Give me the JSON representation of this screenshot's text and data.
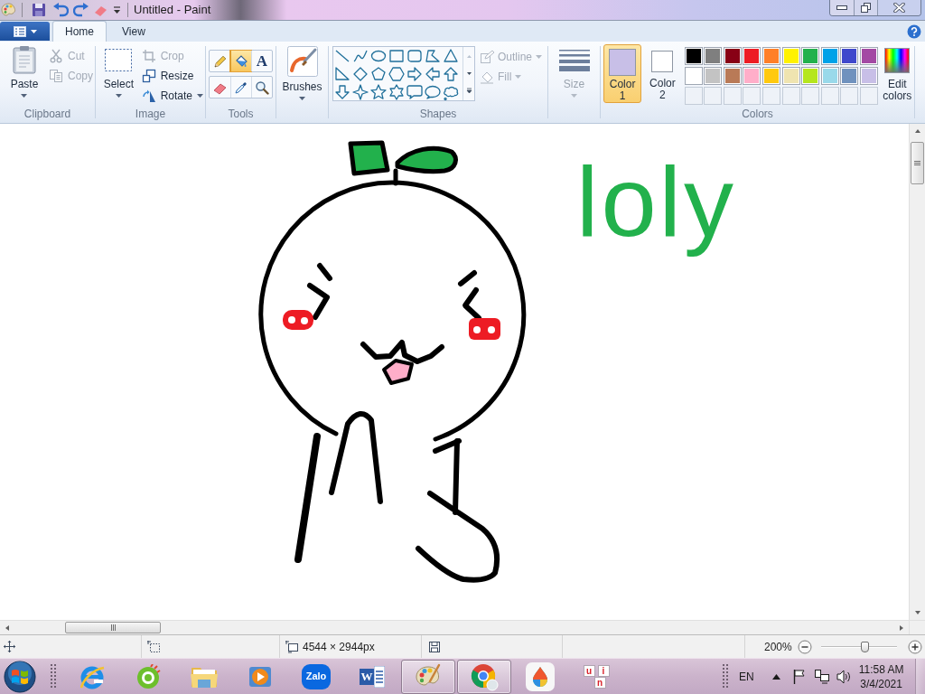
{
  "title_bar": {
    "title": "Untitled - Paint"
  },
  "ribbon_tabs": [
    {
      "label": "Home",
      "selected": true
    },
    {
      "label": "View",
      "selected": false
    }
  ],
  "clipboard": {
    "label": "Clipboard",
    "paste": {
      "label": "Paste"
    },
    "items": [
      {
        "kind": "cut",
        "label": "Cut",
        "disabled": true
      },
      {
        "kind": "copy",
        "label": "Copy",
        "disabled": true
      }
    ]
  },
  "image": {
    "label": "Image",
    "select": {
      "label": "Select"
    },
    "items": [
      {
        "kind": "crop",
        "label": "Crop",
        "disabled": true,
        "dropdown": false
      },
      {
        "kind": "resize",
        "label": "Resize",
        "disabled": false,
        "dropdown": false
      },
      {
        "kind": "rotate",
        "label": "Rotate",
        "disabled": false,
        "dropdown": true
      }
    ]
  },
  "tools": {
    "label": "Tools",
    "items": [
      {
        "kind": "pencil",
        "selected": false
      },
      {
        "kind": "fill",
        "selected": true
      },
      {
        "kind": "text",
        "label": "A",
        "selected": false
      },
      {
        "kind": "eraser",
        "selected": false
      },
      {
        "kind": "picker",
        "selected": false
      },
      {
        "kind": "magnifier",
        "selected": false
      }
    ]
  },
  "brushes": {
    "label": "Brushes"
  },
  "shapes": {
    "label": "Shapes",
    "outline": {
      "label": "Outline",
      "disabled": true
    },
    "fill": {
      "label": "Fill",
      "disabled": true
    }
  },
  "size": {
    "label": "Size",
    "disabled": true
  },
  "colors": {
    "label": "Colors",
    "slots": [
      {
        "label": "Color 1",
        "color": "#c8bfe7",
        "selected": true
      },
      {
        "label": "Color 2",
        "color": "#ffffff",
        "selected": false
      }
    ],
    "palette": [
      {
        "color": "#000000"
      },
      {
        "color": "#7f7f7f"
      },
      {
        "color": "#880015"
      },
      {
        "color": "#ed1c24"
      },
      {
        "color": "#ff7f27"
      },
      {
        "color": "#fff200"
      },
      {
        "color": "#22b14c"
      },
      {
        "color": "#00a2e8"
      },
      {
        "color": "#3f48cc"
      },
      {
        "color": "#a349a4"
      },
      {
        "color": "#ffffff"
      },
      {
        "color": "#c3c3c3"
      },
      {
        "color": "#b97a57"
      },
      {
        "color": "#ffaec9"
      },
      {
        "color": "#ffc90e"
      },
      {
        "color": "#efe4b0"
      },
      {
        "color": "#b5e61d"
      },
      {
        "color": "#99d9ea"
      },
      {
        "color": "#7092be"
      },
      {
        "color": "#c8bfe7"
      }
    ],
    "edit": {
      "label": "Edit colors"
    }
  },
  "canvas": {
    "text": "loly"
  },
  "status_bar": {
    "dimensions": "4544 × 2944px",
    "zoom": {
      "reading": "200%",
      "level": 0.57
    }
  },
  "taskbar": {
    "apps": [
      {
        "kind": "ie",
        "open": false
      },
      {
        "kind": "coccoc",
        "open": false
      },
      {
        "kind": "folder",
        "open": false
      },
      {
        "kind": "media",
        "open": false
      },
      {
        "kind": "chat",
        "label": "Zalo",
        "open": false
      },
      {
        "kind": "word",
        "label": "W",
        "open": false
      },
      {
        "kind": "paint",
        "open": true
      },
      {
        "kind": "chrome",
        "open": true
      },
      {
        "kind": "drop",
        "open": false
      },
      {
        "kind": "keyboard",
        "letters": [
          "u",
          "i",
          "n"
        ],
        "open": false
      }
    ],
    "tray": {
      "language": "EN",
      "time": "11:58 AM",
      "date": "3/4/2021"
    }
  }
}
